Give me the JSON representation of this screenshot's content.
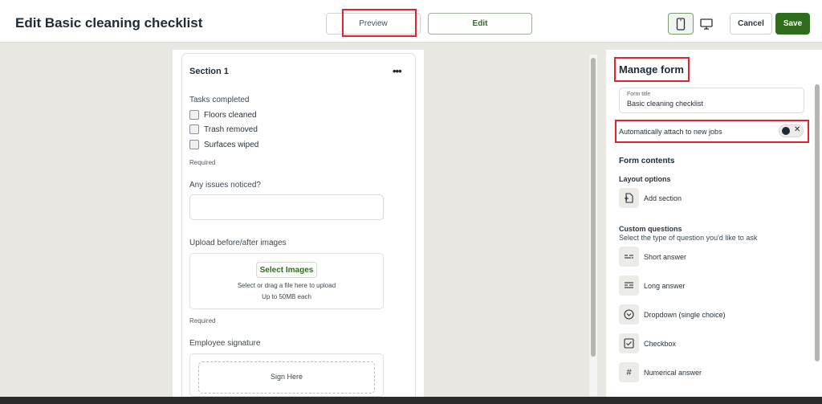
{
  "header": {
    "title": "Edit Basic cleaning checklist",
    "preview_label": "Preview",
    "edit_label": "Edit",
    "cancel_label": "Cancel",
    "save_label": "Save"
  },
  "form": {
    "section_title": "Section 1",
    "tasks_label": "Tasks completed",
    "checkboxes": [
      "Floors cleaned",
      "Trash removed",
      "Surfaces wiped"
    ],
    "required_label": "Required",
    "issues_label": "Any issues noticed?",
    "upload_label": "Upload before/after images",
    "select_images_label": "Select Images",
    "upload_hint": "Select or drag a file here to upload",
    "upload_limit": "Up to 50MB each",
    "signature_label": "Employee signature",
    "sign_here": "Sign Here"
  },
  "panel": {
    "title": "Manage form",
    "form_title_label": "Form title",
    "form_title_value": "Basic cleaning checklist",
    "attach_label": "Automatically attach to new jobs",
    "toggle_close": "✕",
    "form_contents": "Form contents",
    "layout_options": "Layout options",
    "add_section": "Add section",
    "custom_questions": "Custom questions",
    "custom_questions_sub": "Select the type of question you'd like to ask",
    "question_types": [
      "Short answer",
      "Long answer",
      "Dropdown (single choice)",
      "Checkbox",
      "Numerical answer"
    ]
  },
  "colors": {
    "brand_green": "#2f6d1c",
    "highlight_red": "#e0242a"
  }
}
